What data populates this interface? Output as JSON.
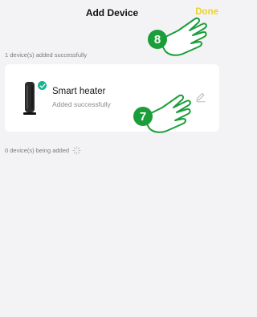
{
  "header": {
    "title": "Add Device",
    "done_label": "Done"
  },
  "sections": {
    "added_label": "1 device(s) added successfully",
    "adding_label": "0 device(s) being added"
  },
  "device": {
    "name": "Smart heater",
    "status": "Added successfully",
    "status_icon": "check-circle-icon",
    "edit_icon": "pencil-icon"
  },
  "hints": {
    "step_top": "8",
    "step_card": "7",
    "hint_color": "#1a9e3a"
  },
  "colors": {
    "accent": "#ecd22a",
    "success": "#19b394"
  }
}
